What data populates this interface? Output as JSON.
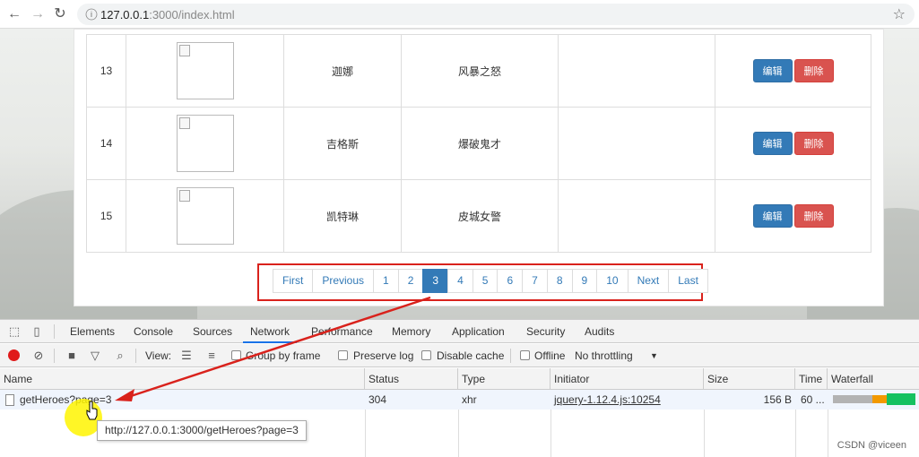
{
  "browser": {
    "url_host": "127.0.0.1",
    "url_rest": ":3000/index.html",
    "back_icon": "←",
    "forward_icon": "→",
    "reload_icon": "↻",
    "info_icon": "i",
    "star_icon": "☆"
  },
  "heroes": [
    {
      "id": "13",
      "name": "迦娜",
      "skill": "风暴之怒",
      "edit": "编辑",
      "delete": "删除"
    },
    {
      "id": "14",
      "name": "吉格斯",
      "skill": "爆破鬼才",
      "edit": "编辑",
      "delete": "删除"
    },
    {
      "id": "15",
      "name": "凯特琳",
      "skill": "皮城女警",
      "edit": "编辑",
      "delete": "删除"
    }
  ],
  "pagination": {
    "first": "First",
    "previous": "Previous",
    "pages": [
      "1",
      "2",
      "3",
      "4",
      "5",
      "6",
      "7",
      "8",
      "9",
      "10"
    ],
    "active_page": "3",
    "next": "Next",
    "last": "Last"
  },
  "devtools": {
    "tabs": [
      "Elements",
      "Console",
      "Sources",
      "Network",
      "Performance",
      "Memory",
      "Application",
      "Security",
      "Audits"
    ],
    "active_tab": "Network",
    "toolbar": {
      "view_label": "View:",
      "group_by_frame": "Group by frame",
      "preserve_log": "Preserve log",
      "disable_cache": "Disable cache",
      "offline": "Offline",
      "throttling": "No throttling"
    },
    "columns": [
      "Name",
      "Status",
      "Type",
      "Initiator",
      "Size",
      "Time",
      "Waterfall"
    ],
    "request": {
      "name": "getHeroes?page=3",
      "status": "304",
      "type": "xhr",
      "initiator": "jquery-1.12.4.js:10254",
      "size": "156 B",
      "time": "60 ..."
    },
    "tooltip": "http://127.0.0.1:3000/getHeroes?page=3"
  },
  "watermark": "CSDN @viceen",
  "colors": {
    "primary": "#337ab7",
    "danger": "#d9534f",
    "annotation": "#d9221c",
    "record": "#e01a1a"
  }
}
